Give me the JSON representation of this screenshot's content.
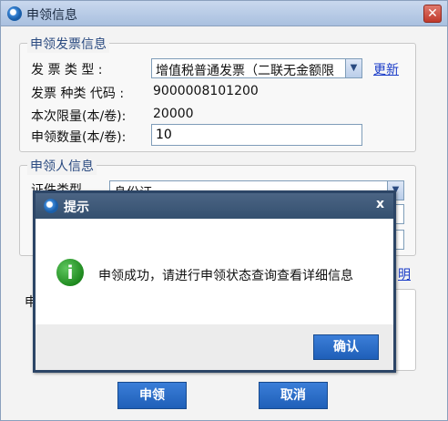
{
  "window": {
    "title": "申领信息",
    "close_glyph": "✕"
  },
  "invoice_group": {
    "title": "申领发票信息",
    "type_label": "发  票  类  型 :",
    "type_value": "增值税普通发票（二联无金额限",
    "refresh_link": "更新",
    "code_label": "发票 种类 代码 :",
    "code_value": "9000008101200",
    "limit_label": "本次限量(本/卷):",
    "limit_value": "20000",
    "qty_label": "申领数量(本/卷):",
    "qty_value": "10"
  },
  "applicant_group": {
    "title": "申领人信息",
    "id_type_label": "证件类型",
    "id_type_value": "身份证"
  },
  "background": {
    "detail_link_fragment": "明",
    "row_fragment": "申"
  },
  "buttons": {
    "apply": "申领",
    "cancel": "取消"
  },
  "popup": {
    "title": "提示",
    "close_glyph": "x",
    "icon_glyph": "i",
    "message": "申领成功，请进行申领状态查询查看详细信息",
    "ok": "确认"
  }
}
